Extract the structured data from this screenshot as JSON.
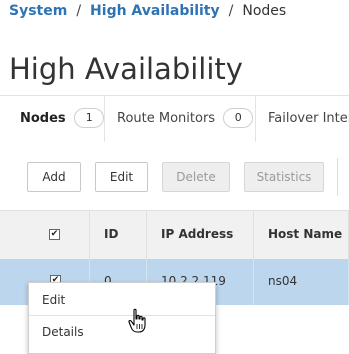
{
  "breadcrumb": {
    "items": [
      "System",
      "High Availability",
      "Nodes"
    ],
    "separator": "/"
  },
  "page": {
    "title": "High Availability"
  },
  "tabs": [
    {
      "label": "Nodes",
      "count": "1",
      "active": true
    },
    {
      "label": "Route Monitors",
      "count": "0",
      "active": false
    },
    {
      "label": "Failover Interfa",
      "active": false
    }
  ],
  "toolbar": {
    "add_label": "Add",
    "edit_label": "Edit",
    "delete_label": "Delete",
    "statistics_label": "Statistics"
  },
  "table": {
    "columns": [
      "ID",
      "IP Address",
      "Host Name"
    ],
    "rows": [
      {
        "checked": true,
        "id": "0",
        "ip": "10.2.2.119",
        "host": "ns04"
      }
    ]
  },
  "context_menu": {
    "items": [
      "Edit",
      "Details"
    ]
  },
  "colors": {
    "link": "#2e74b5",
    "selected_row": "#bcd6ee",
    "header_bg": "#f1f1f1"
  },
  "icons": {
    "select_all_checkbox": "checkbox-checked",
    "cursor": "hand-pointer"
  }
}
